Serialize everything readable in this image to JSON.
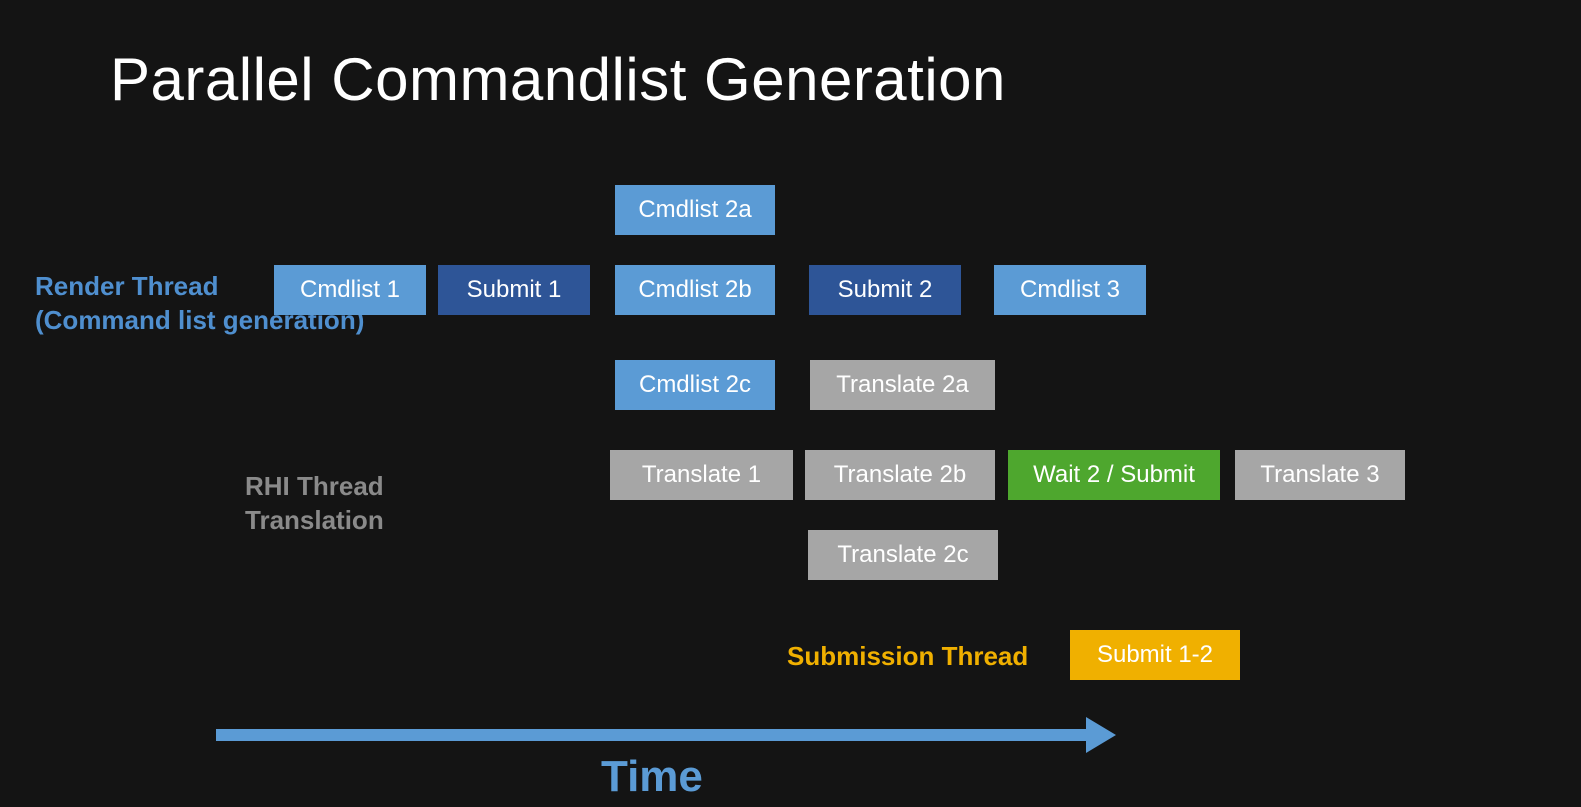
{
  "title": "Parallel Commandlist Generation",
  "labels": {
    "render_line1": "Render Thread",
    "render_line2": "(Command list generation)",
    "rhi_line1": "RHI Thread",
    "rhi_line2": "Translation",
    "submission": "Submission Thread",
    "time": "Time"
  },
  "boxes": {
    "cmdlist1": "Cmdlist 1",
    "submit1": "Submit 1",
    "cmdlist2a": "Cmdlist 2a",
    "cmdlist2b": "Cmdlist 2b",
    "cmdlist2c": "Cmdlist 2c",
    "submit2": "Submit 2",
    "cmdlist3": "Cmdlist 3",
    "translate1": "Translate 1",
    "translate2a": "Translate 2a",
    "translate2b": "Translate 2b",
    "translate2c": "Translate 2c",
    "wait2": "Wait 2 / Submit",
    "translate3": "Translate 3",
    "submit12": "Submit 1-2"
  },
  "colors": {
    "light_blue": "#5b9bd5",
    "dark_blue": "#2e5597",
    "gray": "#a6a6a6",
    "green": "#4ea72e",
    "yellow": "#f0b000",
    "background": "#141414",
    "text": "#ffffff"
  }
}
